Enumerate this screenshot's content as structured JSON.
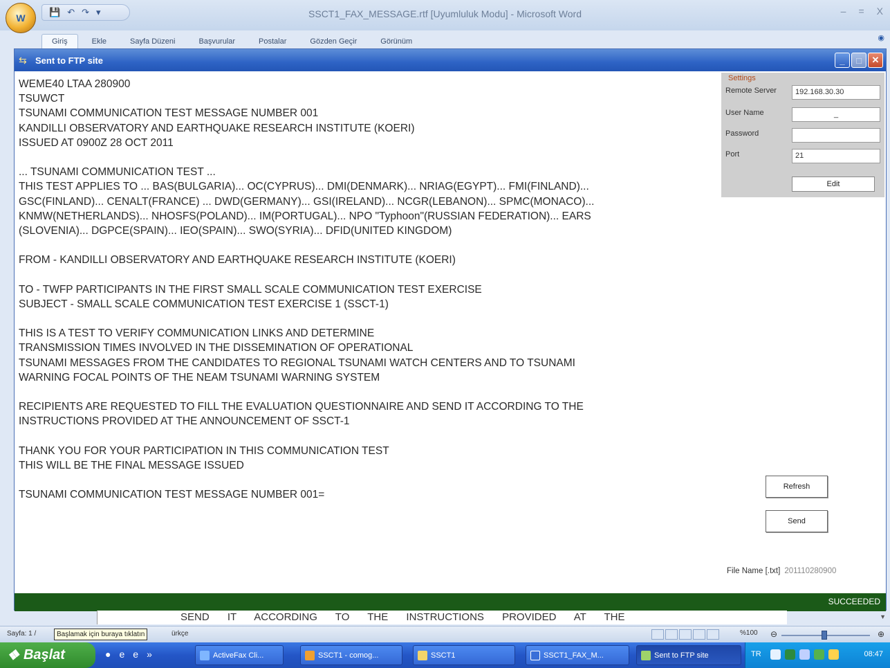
{
  "word": {
    "title": "SSCT1_FAX_MESSAGE.rtf [Uyumluluk Modu] - Microsoft Word",
    "office_button": "W",
    "tabs": [
      "Giriş",
      "Ekle",
      "Sayfa Düzeni",
      "Başvurular",
      "Postalar",
      "Gözden Geçir",
      "Görünüm"
    ],
    "active_tab": 0
  },
  "dialog": {
    "title": "Sent to FTP site",
    "message_lines": [
      "WEME40 LTAA 280900",
      "TSUWCT",
      "TSUNAMI COMMUNICATION TEST MESSAGE NUMBER 001",
      "KANDILLI OBSERVATORY AND EARTHQUAKE RESEARCH INSTITUTE (KOERI)",
      "ISSUED AT 0900Z 28 OCT 2011",
      "",
      "... TSUNAMI COMMUNICATION TEST ...",
      "THIS TEST APPLIES TO ... BAS(BULGARIA)... OC(CYPRUS)... DMI(DENMARK)... NRIAG(EGYPT)... FMI(FINLAND)...",
      "GSC(FINLAND)... CENALT(FRANCE) ... DWD(GERMANY)... GSI(IRELAND)... NCGR(LEBANON)... SPMC(MONACO)...",
      "KNMW(NETHERLANDS)... NHOSFS(POLAND)... IM(PORTUGAL)... NPO \"Typhoon\"(RUSSIAN FEDERATION)... EARS",
      "(SLOVENIA)... DGPCE(SPAIN)... IEO(SPAIN)... SWO(SYRIA)... DFID(UNITED KINGDOM)",
      "",
      "FROM - KANDILLI OBSERVATORY AND EARTHQUAKE RESEARCH INSTITUTE (KOERI)",
      "",
      "TO - TWFP PARTICIPANTS IN THE FIRST SMALL SCALE COMMUNICATION TEST EXERCISE",
      "SUBJECT - SMALL SCALE COMMUNICATION TEST EXERCISE 1 (SSCT-1)",
      "",
      "THIS IS A TEST TO VERIFY COMMUNICATION LINKS AND DETERMINE",
      "TRANSMISSION TIMES INVOLVED IN THE DISSEMINATION OF OPERATIONAL",
      "TSUNAMI MESSAGES FROM THE CANDIDATES TO REGIONAL TSUNAMI WATCH CENTERS AND TO TSUNAMI",
      "WARNING FOCAL POINTS OF THE NEAM TSUNAMI WARNING SYSTEM",
      "",
      "RECIPIENTS ARE REQUESTED TO FILL THE EVALUATION QUESTIONNAIRE AND SEND IT ACCORDING TO THE",
      "INSTRUCTIONS PROVIDED AT THE ANNOUNCEMENT OF SSCT-1",
      "",
      "THANK YOU FOR YOUR PARTICIPATION IN THIS COMMUNICATION TEST",
      "THIS WILL BE THE FINAL MESSAGE ISSUED",
      "",
      "TSUNAMI COMMUNICATION TEST MESSAGE NUMBER 001="
    ],
    "settings": {
      "legend": "Settings",
      "remote_server_label": "Remote Server",
      "remote_server_value": "192.168.30.30",
      "user_name_label": "User Name",
      "user_name_value": "_",
      "password_label": "Password",
      "password_value": "",
      "port_label": "Port",
      "port_value": "21",
      "edit_label": "Edit"
    },
    "refresh_label": "Refresh",
    "send_label": "Send",
    "file_name_label": "File Name [.txt]",
    "file_name_value": "201110280900",
    "status": "SUCCEEDED"
  },
  "document_strip": "SEND IT ACCORDING TO THE INSTRUCTIONS PROVIDED AT THE",
  "word_status": {
    "page": "Sayfa: 1 /",
    "tooltip": "Başlamak için buraya tıklatın",
    "language": "ürkçe",
    "zoom": "%100"
  },
  "taskbar": {
    "start_label": "Başlat",
    "tasks": [
      "ActiveFax Cli...",
      "SSCT1 - comog...",
      "SSCT1",
      "SSCT1_FAX_M...",
      "Sent to FTP site"
    ],
    "tray_lang": "TR",
    "time": "08:47"
  }
}
